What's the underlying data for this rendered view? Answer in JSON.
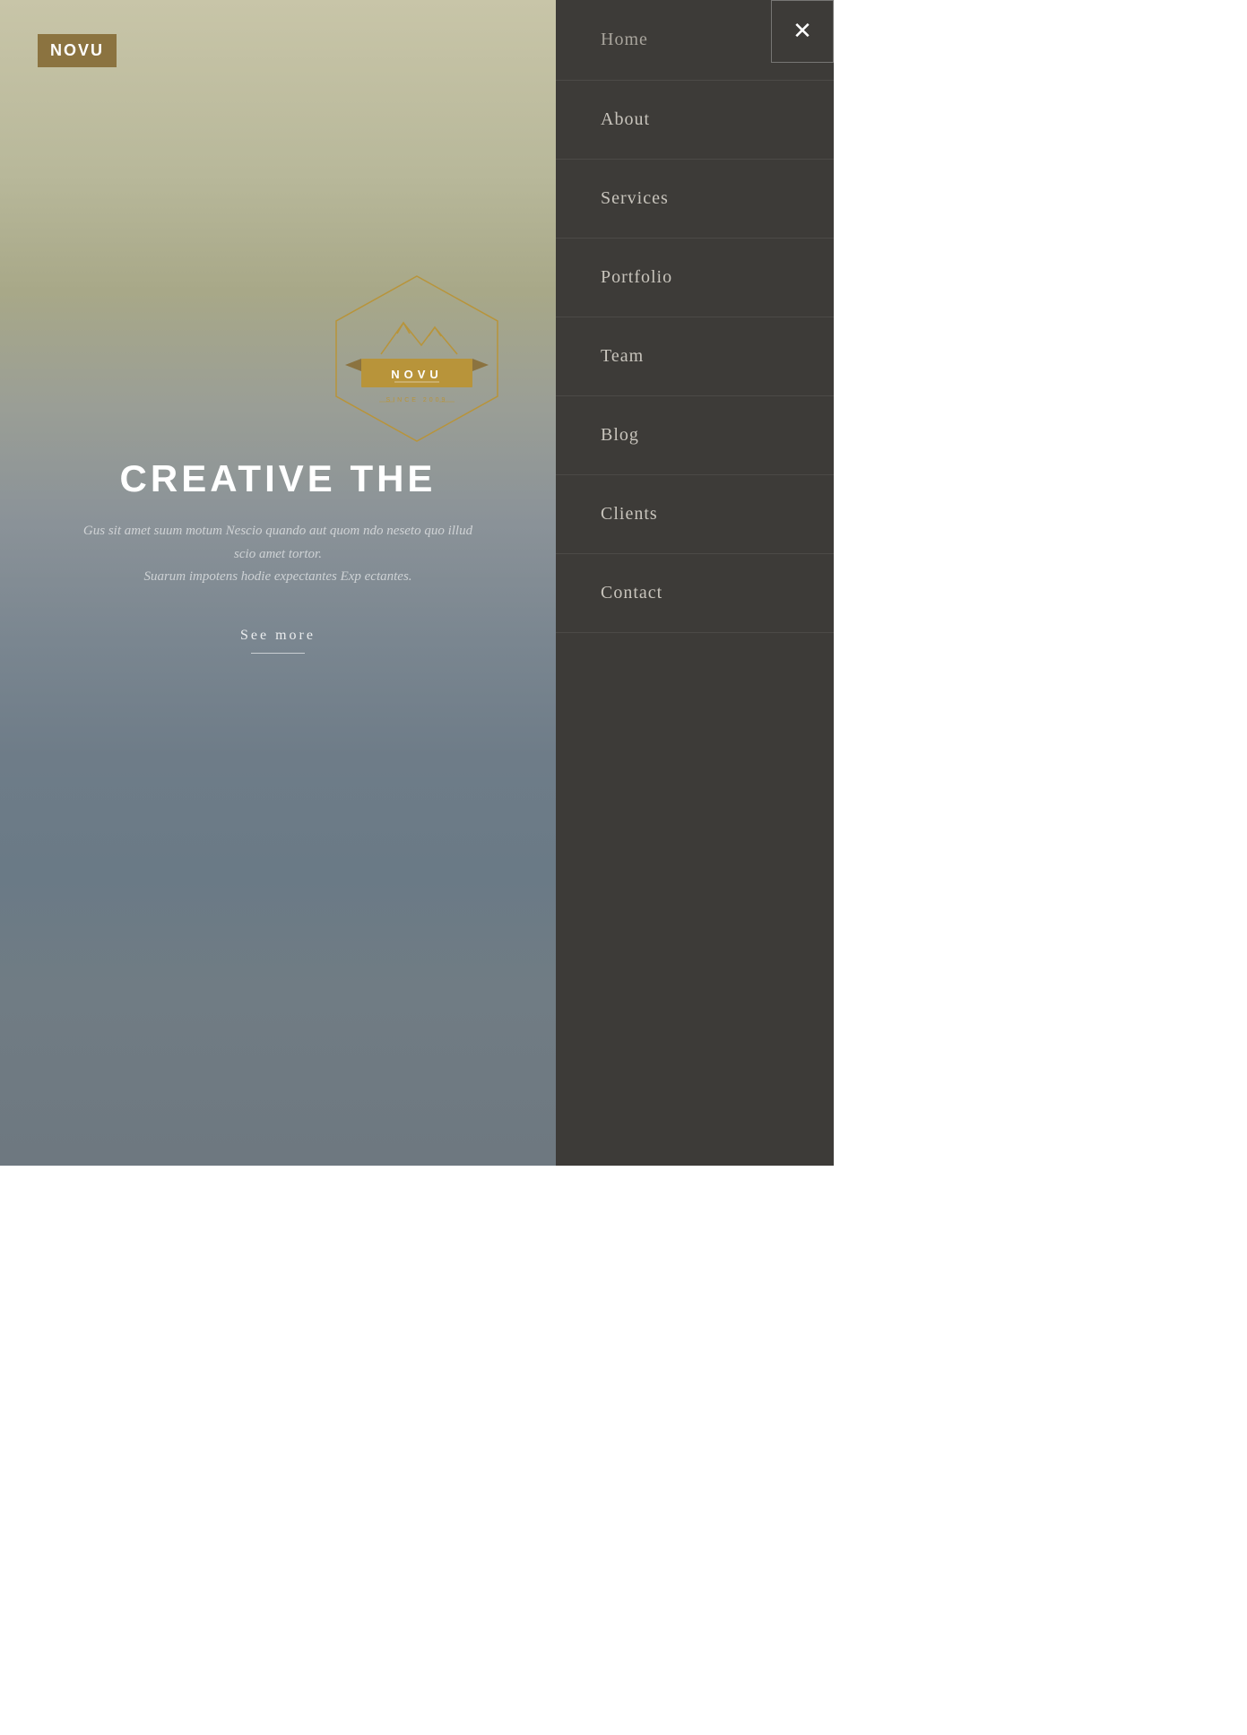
{
  "logo": {
    "text": "NOVU"
  },
  "badge": {
    "name": "NOVU",
    "since": "SINCE 2009"
  },
  "hero": {
    "title": "CREATIVE THE",
    "subtitle_line1": "Gus sit amet suum motum Nescio quando aut quom ndo neseto quo illud",
    "subtitle_line2": "scio amet tortor.",
    "subtitle_line3": "Suarum impotens hodie expectantes Exp ectantes.",
    "cta": "See more"
  },
  "nav": {
    "close_label": "✕",
    "items": [
      {
        "label": "Home"
      },
      {
        "label": "About"
      },
      {
        "label": "Services"
      },
      {
        "label": "Portfolio"
      },
      {
        "label": "Team"
      },
      {
        "label": "Blog"
      },
      {
        "label": "Clients"
      },
      {
        "label": "Contact"
      }
    ]
  },
  "colors": {
    "accent_gold": "#8B7340",
    "nav_bg": "#3d3b38",
    "nav_text": "#c8c4bc"
  }
}
